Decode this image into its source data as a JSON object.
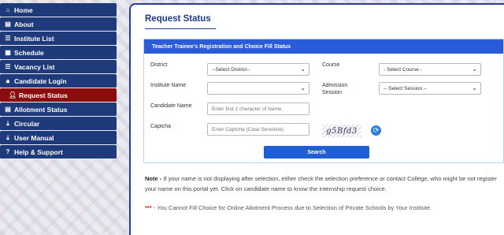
{
  "sidebar": {
    "items": [
      {
        "label": "Home",
        "icon": "home-icon",
        "glyph": "⌂",
        "active": false
      },
      {
        "label": "About",
        "icon": "info-icon",
        "glyph": "▤",
        "active": false
      },
      {
        "label": "Institute List",
        "icon": "list-icon",
        "glyph": "☰",
        "active": false
      },
      {
        "label": "Schedule",
        "icon": "calendar-icon",
        "glyph": "▦",
        "active": false
      },
      {
        "label": "Vacancy List",
        "icon": "list-icon",
        "glyph": "☰",
        "active": false
      },
      {
        "label": "Candidate Login",
        "icon": "lock-icon",
        "glyph": "🔒︎",
        "active": false
      },
      {
        "label": "Request Status",
        "icon": "user-plus-icon",
        "glyph": "👤︎",
        "active": true
      },
      {
        "label": "Allotment Status",
        "icon": "document-icon",
        "glyph": "▤",
        "active": false
      },
      {
        "label": "Circular",
        "icon": "download-icon",
        "glyph": "⤓",
        "active": false
      },
      {
        "label": "User Manual",
        "icon": "download-icon",
        "glyph": "⤓",
        "active": false
      },
      {
        "label": "Help & Support",
        "icon": "help-icon",
        "glyph": "?",
        "active": false
      }
    ]
  },
  "main": {
    "title": "Request Status",
    "card_title": "Teacher Trainee's Registration and Choice Fill Status",
    "form": {
      "district_label": "District",
      "district_value": "--Select District--",
      "course_label": "Course",
      "course_value": "- Select Course -",
      "institute_label": "Institute Name",
      "institute_value": "",
      "session_label_1": "Admission",
      "session_label_2": "Session",
      "session_value": "-- Select Session --",
      "candidate_label": "Candidate Name",
      "candidate_placeholder": "Enter first 2 character of Name",
      "captcha_label": "Captcha",
      "captcha_placeholder": "Enter Captcha (Case Sensitive)",
      "captcha_text": "g5Bfd3",
      "search_label": "Search"
    },
    "note_label": "Note -",
    "note_text": " If your name is not displaying after selection, either check the selection preference or contact College, who might be not register your name on this portal yet. Click on candidate name to know the internship request choice.",
    "warning_stars": "***",
    "warning_text": " - You Cannot Fill Choice for Online Allotment Process due to Selection of Private Schools by Your Institute."
  },
  "colors": {
    "sidebar_bg": "#1f3a7a",
    "sidebar_active": "#8a0c0c",
    "card_header": "#2a5bd8",
    "button": "#1f5fd6",
    "warning": "#d9241b"
  }
}
